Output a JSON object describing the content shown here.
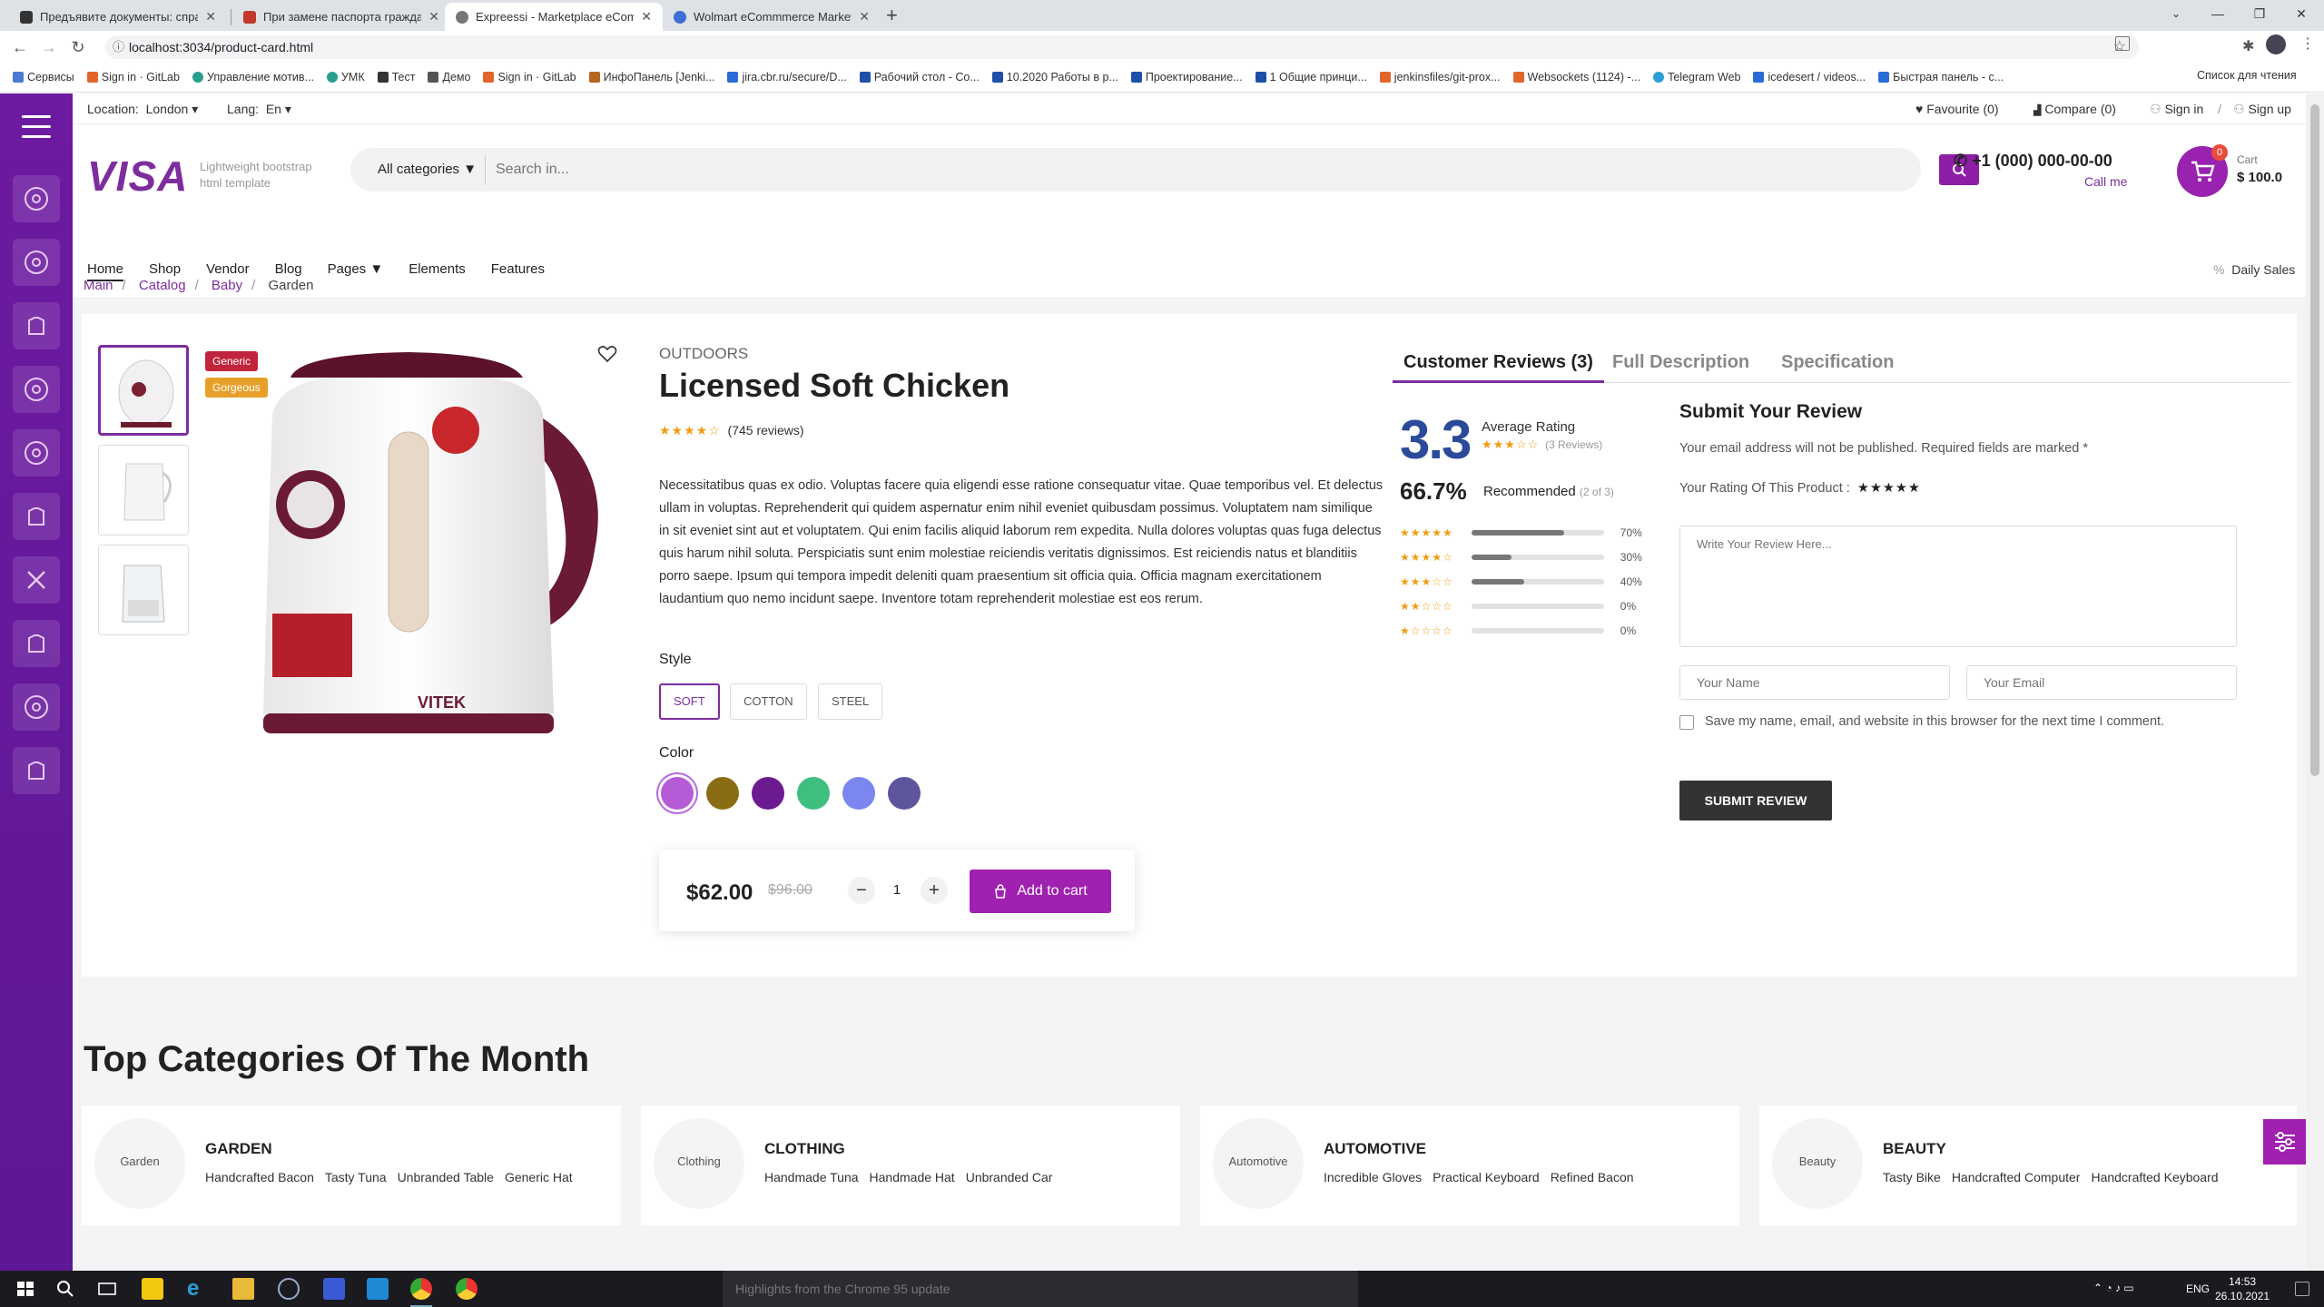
{
  "browser": {
    "tabs": [
      {
        "title": "Предъявите документы: справк",
        "color": "#333"
      },
      {
        "title": "При замене паспорта граждани",
        "color": "#c0392b"
      },
      {
        "title": "Expreessi - Marketplace eComme",
        "color": "#666"
      },
      {
        "title": "Wolmart eCommmerce Marketpl",
        "color": "#3b6fd6"
      }
    ],
    "url": "localhost:3034/product-card.html",
    "bookmarks": [
      "Сервисы",
      "Sign in · GitLab",
      "Управление мотив...",
      "УМК",
      "Тест",
      "Демо",
      "Sign in · GitLab",
      "ИнфоПанель [Jenki...",
      "jira.cbr.ru/secure/D...",
      "Рабочий стол - Co...",
      "10.2020 Работы в р...",
      "Проектирование...",
      "1 Общие принци...",
      "jenkinsfiles/git-prox...",
      "Websockets (1124) -...",
      "Telegram Web",
      "icedesert / videos...",
      "Быстрая панель - с..."
    ],
    "reading_list": "Список для чтения"
  },
  "topbar": {
    "location_label": "Location:",
    "location": "London",
    "lang_label": "Lang:",
    "lang": "En",
    "favourite": "Favourite (0)",
    "compare": "Compare (0)",
    "signin": "Sign in",
    "sep": "/",
    "signup": "Sign up"
  },
  "header": {
    "logo": "VISA",
    "tagline": "Lightweight bootstrap html template",
    "category_select": "All categories",
    "search_placeholder": "Search in...",
    "phone": "+1 (000) 000-00-00",
    "call_me": "Call me",
    "cart_count": "0",
    "cart_label": "Cart",
    "cart_total": "$ 100.0",
    "daily_sales": "Daily Sales"
  },
  "menu": [
    "Home",
    "Shop",
    "Vendor",
    "Blog",
    "Pages",
    "Elements",
    "Features"
  ],
  "breadcrumb": [
    "Main",
    "Catalog",
    "Baby",
    "Garden"
  ],
  "product": {
    "badges": [
      {
        "text": "Generic",
        "color": "#c0253d"
      },
      {
        "text": "Gorgeous",
        "color": "#e6a02a"
      }
    ],
    "category": "OUTDOORS",
    "title": "Licensed Soft Chicken",
    "rating": 4,
    "reviews": "(745 reviews)",
    "description": "Necessitatibus quas ex odio. Voluptas facere quia eligendi esse ratione consequatur vitae. Quae temporibus vel. Et delectus ullam in voluptas. Reprehenderit qui quidem aspernatur enim nihil eveniet quibusdam possimus. Voluptatem nam similique in sit eveniet sint aut et voluptatem. Qui enim facilis aliquid laborum rem expedita. Nulla dolores voluptas quas fuga delectus quis harum nihil soluta. Perspiciatis sunt enim molestiae reiciendis veritatis dignissimos. Est reiciendis natus et blanditiis porro saepe. Ipsum qui tempora impedit deleniti quam praesentium sit officia quia. Officia magnam exercitationem laudantium quo nemo incidunt saepe. Inventore totam reprehenderit molestiae est eos rerum.",
    "style_label": "Style",
    "styles": [
      "SOFT",
      "COTTON",
      "STEEL"
    ],
    "color_label": "Color",
    "colors": [
      "#b65bd6",
      "#8a6c14",
      "#6b1a8f",
      "#3fbf7f",
      "#7b86f0",
      "#5e569c"
    ],
    "price": "$62.00",
    "old_price": "$96.00",
    "quantity": "1",
    "add_to_cart": "Add to cart",
    "image_brand": "VITEK"
  },
  "reviews": {
    "tabs": [
      "Customer Reviews (3)",
      "Full Description",
      "Specification"
    ],
    "score": "3.3",
    "avg_label": "Average Rating",
    "avg_count": "(3 Reviews)",
    "recommended_pct": "66.7%",
    "recommended_label": "Recommended",
    "recommended_sub": "(2 of 3)",
    "breakdown": [
      {
        "stars": 5,
        "pct": "70%",
        "fill": 0.7
      },
      {
        "stars": 4,
        "pct": "30%",
        "fill": 0.3
      },
      {
        "stars": 3,
        "pct": "40%",
        "fill": 0.4
      },
      {
        "stars": 2,
        "pct": "0%",
        "fill": 0
      },
      {
        "stars": 1,
        "pct": "0%",
        "fill": 0
      }
    ],
    "form_title": "Submit Your Review",
    "form_note": "Your email address will not be published. Required fields are marked *",
    "rating_label": "Your Rating Of This Product :",
    "textarea_placeholder": "Write Your Review Here...",
    "name_placeholder": "Your Name",
    "email_placeholder": "Your Email",
    "save_label": "Save my name, email, and website in this browser for the next time I comment.",
    "submit": "SUBMIT REVIEW"
  },
  "top_categories": {
    "title": "Top Categories Of The Month",
    "items": [
      {
        "name": "GARDEN",
        "img_alt": "Garden",
        "links": [
          "Handcrafted Bacon",
          "Tasty Tuna",
          "Unbranded Table",
          "Generic Hat"
        ]
      },
      {
        "name": "CLOTHING",
        "img_alt": "Clothing",
        "links": [
          "Handmade Tuna",
          "Handmade Hat",
          "Unbranded Car"
        ]
      },
      {
        "name": "AUTOMOTIVE",
        "img_alt": "Automotive",
        "links": [
          "Incredible Gloves",
          "Practical Keyboard",
          "Refined Bacon"
        ]
      },
      {
        "name": "BEAUTY",
        "img_alt": "Beauty",
        "links": [
          "Tasty Bike",
          "Handcrafted Computer",
          "Handcrafted Keyboard"
        ]
      }
    ]
  },
  "taskbar": {
    "notification": "Highlights from the Chrome 95 update",
    "lang": "ENG",
    "time": "14:53",
    "date": "26.10.2021"
  }
}
